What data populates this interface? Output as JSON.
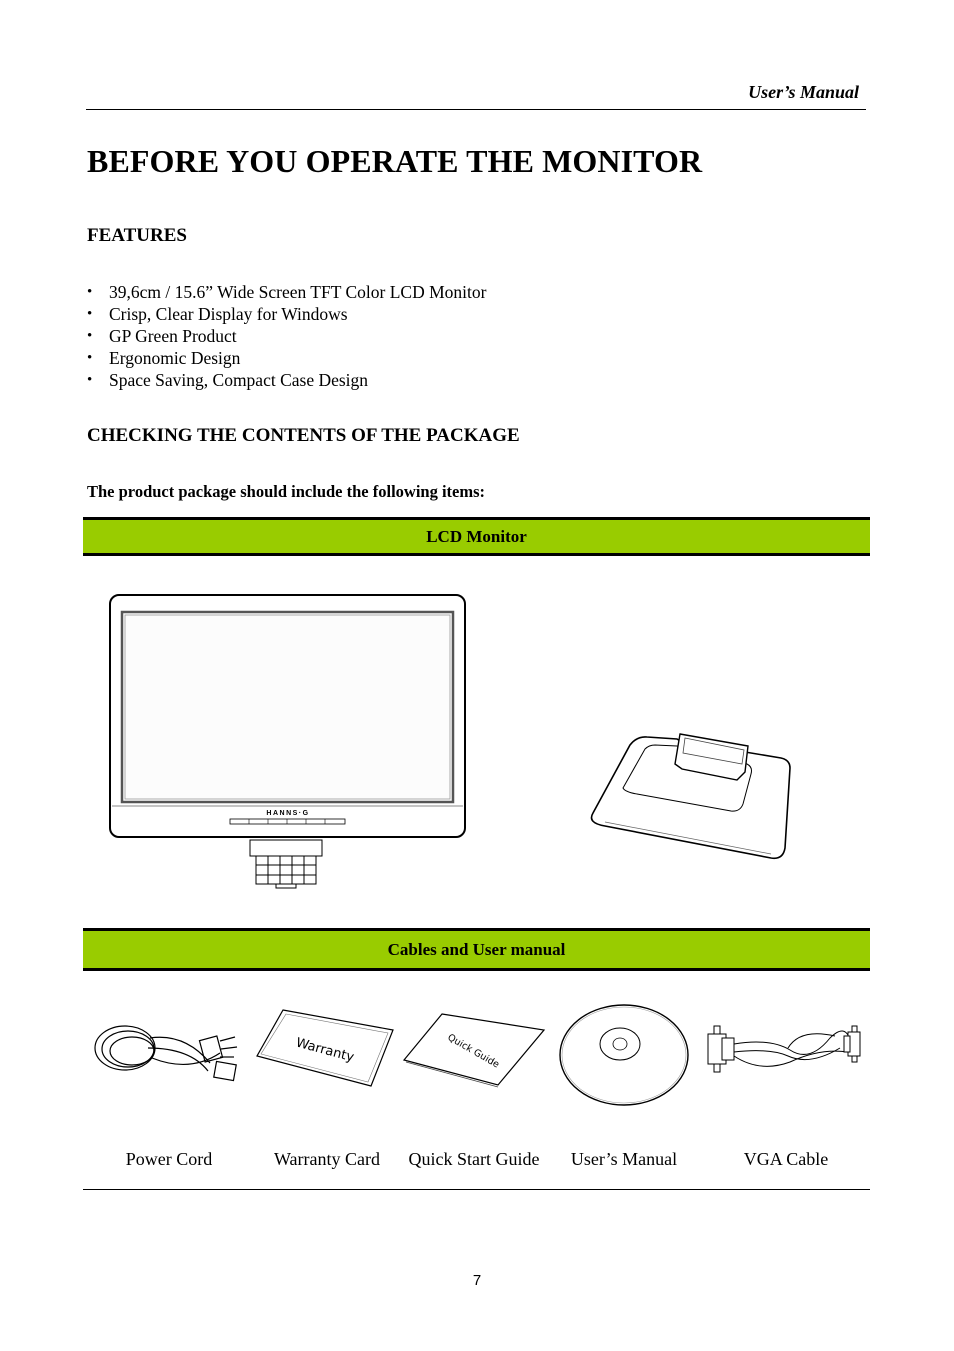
{
  "header": {
    "running_title": "User’s Manual"
  },
  "title": "BEFORE YOU OPERATE THE MONITOR",
  "features": {
    "heading": "FEATURES",
    "items": [
      "39,6cm / 15.6” Wide Screen TFT Color LCD Monitor",
      "Crisp, Clear Display for Windows",
      "GP Green Product",
      "Ergonomic Design",
      "Space Saving, Compact Case Design"
    ]
  },
  "package": {
    "heading": "CHECKING THE CONTENTS OF THE PACKAGE",
    "intro": "The product package should include the following items:",
    "sections": [
      {
        "title": "LCD Monitor",
        "items": [
          "monitor-illustration",
          "stand-base-illustration"
        ]
      },
      {
        "title": "Cables and User manual"
      }
    ],
    "monitor_brand": "HANNS·G",
    "cover_texts": {
      "warranty": "Warranty",
      "quick_guide": "Quick Guide"
    },
    "accessories": [
      {
        "label": "Power Cord",
        "icon": "power-cord-icon"
      },
      {
        "label": "Warranty Card",
        "icon": "warranty-card-icon"
      },
      {
        "label": "Quick Start Guide",
        "icon": "quick-guide-icon"
      },
      {
        "label": "User’s Manual",
        "icon": "cd-disc-icon"
      },
      {
        "label": "VGA Cable",
        "icon": "vga-cable-icon"
      }
    ]
  },
  "colors": {
    "band": "#99cc00"
  },
  "footer": {
    "page_number": "7"
  }
}
